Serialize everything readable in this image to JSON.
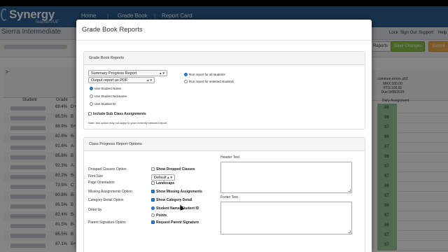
{
  "app": {
    "logo": "Synergy",
    "logo_sub": "TeacherVUE",
    "nav": [
      "Home",
      "Grade Book",
      "Report Card"
    ],
    "school_name": "Sierra Intermediate",
    "header_links": [
      "Lock",
      "Sign Out",
      "Support",
      "Help"
    ],
    "toolbar": {
      "button_reports": "Reports",
      "button_save_changes": "Save Changes",
      "button_submit": "Submit"
    },
    "grid": {
      "student_header": "Student",
      "grade_header": "Grade",
      "toggle": ">",
      "rows": [
        {
          "pct": "69.4%",
          "letter": "D+"
        },
        {
          "pct": "85.5%",
          "letter": "B"
        },
        {
          "pct": "88.9%",
          "letter": "B+"
        },
        {
          "pct": "82.8%",
          "letter": "B-"
        },
        {
          "pct": "91.6%",
          "letter": "A-"
        },
        {
          "pct": "85.8%",
          "letter": "B"
        },
        {
          "pct": "92.3%",
          "letter": "A-"
        },
        {
          "pct": "82.2%",
          "letter": "B-"
        },
        {
          "pct": "73.9%",
          "letter": "C"
        },
        {
          "pct": "80.8%",
          "letter": "B-"
        },
        {
          "pct": "85.5%",
          "letter": "B"
        },
        {
          "pct": "82.4%",
          "letter": "B-"
        },
        {
          "pct": "81.5%",
          "letter": "B-"
        },
        {
          "pct": "85.5%",
          "letter": "B"
        },
        {
          "pct": "87.1%",
          "letter": "B+"
        }
      ]
    },
    "right_column": {
      "assignment_title": "common errors p83",
      "max": "MAX:100.00",
      "pts": "PTS:100.00",
      "due": "Due:9/08/2015",
      "date": "9/08/2015",
      "label": "Daily Assignment",
      "scores": [
        "86",
        "96",
        "97",
        "86",
        "97",
        "96",
        "97",
        "97",
        "96",
        "97",
        "96",
        "97",
        "96",
        "97",
        "97"
      ]
    }
  },
  "modal": {
    "title": "Grade Book Reports",
    "section1": {
      "title": "Grade Book Reports",
      "report_select": "Summary Progress Report",
      "output_select": "Output report as PDF",
      "name_options": [
        {
          "label": "Use Student Name",
          "checked": true
        },
        {
          "label": "Use Student Nickname",
          "checked": false
        },
        {
          "label": "Use Student ID",
          "checked": false
        }
      ],
      "run_options": [
        {
          "label": "Run report for all students",
          "checked": true
        },
        {
          "label": "Run report for selected students",
          "checked": false
        }
      ],
      "include_sub_label": "Include Sub Class Assignments",
      "include_sub_checked": false,
      "note": "Note: this option may not apply to your currently selected report."
    },
    "section2": {
      "title": "Class Progress Report Options",
      "labels": {
        "dropped": "Dropped Classes Option",
        "font_size": "Font Size",
        "orientation": "Page Orientation",
        "missing": "Missing Assignments Option",
        "category": "Category Detail Option",
        "order_by": "Order by",
        "parent_sig": "Parent Signature Option"
      },
      "show_dropped_label": "Show Dropped Classes",
      "show_dropped_checked": false,
      "font_size_value": "Default",
      "landscape_label": "Landscape",
      "landscape_checked": false,
      "show_missing_label": "Show Missing Assignments",
      "show_missing_checked": true,
      "show_category_label": "Show Category Detail",
      "show_category_checked": true,
      "order_options": [
        {
          "label": "Student Name/ Student ID",
          "checked": true
        },
        {
          "label": "Points",
          "checked": false
        }
      ],
      "request_sig_label": "Request Parent Signature",
      "request_sig_checked": true,
      "header_text_label": "Header Text",
      "footer_text_label": "Footer Text"
    }
  }
}
